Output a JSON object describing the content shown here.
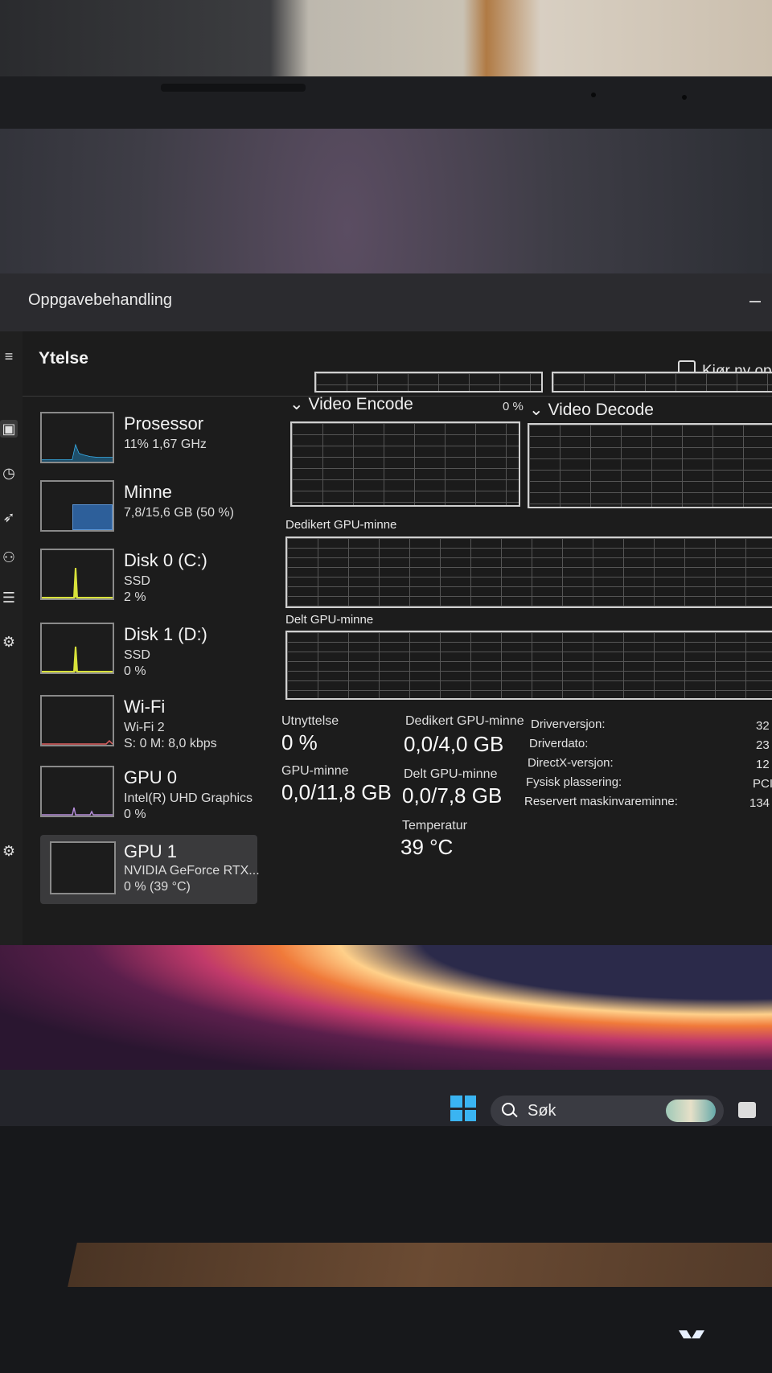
{
  "window": {
    "title": "Oppgavebehandling",
    "section": "Ytelse",
    "run_new_task": "Kjør ny op"
  },
  "devices": [
    {
      "name": "Prosessor",
      "sub1": "11% 1,67 GHz",
      "sub2": ""
    },
    {
      "name": "Minne",
      "sub1": "7,8/15,6 GB (50 %)",
      "sub2": ""
    },
    {
      "name": "Disk 0 (C:)",
      "sub1": "SSD",
      "sub2": "2 %"
    },
    {
      "name": "Disk 1 (D:)",
      "sub1": "SSD",
      "sub2": "0 %"
    },
    {
      "name": "Wi-Fi",
      "sub1": "Wi-Fi 2",
      "sub2": "S: 0 M: 8,0 kbps"
    },
    {
      "name": "GPU 0",
      "sub1": "Intel(R) UHD Graphics",
      "sub2": "0 %"
    },
    {
      "name": "GPU 1",
      "sub1": "NVIDIA GeForce RTX...",
      "sub2": "0 % (39 °C)"
    }
  ],
  "graphs": {
    "video_encode": "Video Encode",
    "video_encode_pct": "0 %",
    "video_decode": "Video Decode",
    "dedicated_mem": "Dedikert GPU-minne",
    "shared_mem": "Delt GPU-minne"
  },
  "stats": {
    "utilization_label": "Utnyttelse",
    "utilization_value": "0 %",
    "gpu_mem_label": "GPU-minne",
    "gpu_mem_value": "0,0/11,8 GB",
    "dedicated_label": "Dedikert GPU-minne",
    "dedicated_value": "0,0/4,0 GB",
    "shared_label": "Delt GPU-minne",
    "shared_value": "0,0/7,8 GB",
    "temp_label": "Temperatur",
    "temp_value": "39 °C"
  },
  "info": [
    {
      "label": "Driverversjon:",
      "value": "32"
    },
    {
      "label": "Driverdato:",
      "value": "23"
    },
    {
      "label": "DirectX-versjon:",
      "value": "12"
    },
    {
      "label": "Fysisk plassering:",
      "value": "PCI"
    },
    {
      "label": "Reservert maskinvareminne:",
      "value": "134"
    }
  ],
  "taskbar": {
    "search_placeholder": "Søk"
  },
  "icons": {
    "start": "windows-start-icon",
    "search": "search-icon",
    "run_task": "run-task-icon",
    "settings": "gear-icon"
  },
  "colors": {
    "accent_blue": "#3ab4f2",
    "graph_line_yellow": "#d8e23a",
    "memory_fill": "#2d5f9a"
  }
}
